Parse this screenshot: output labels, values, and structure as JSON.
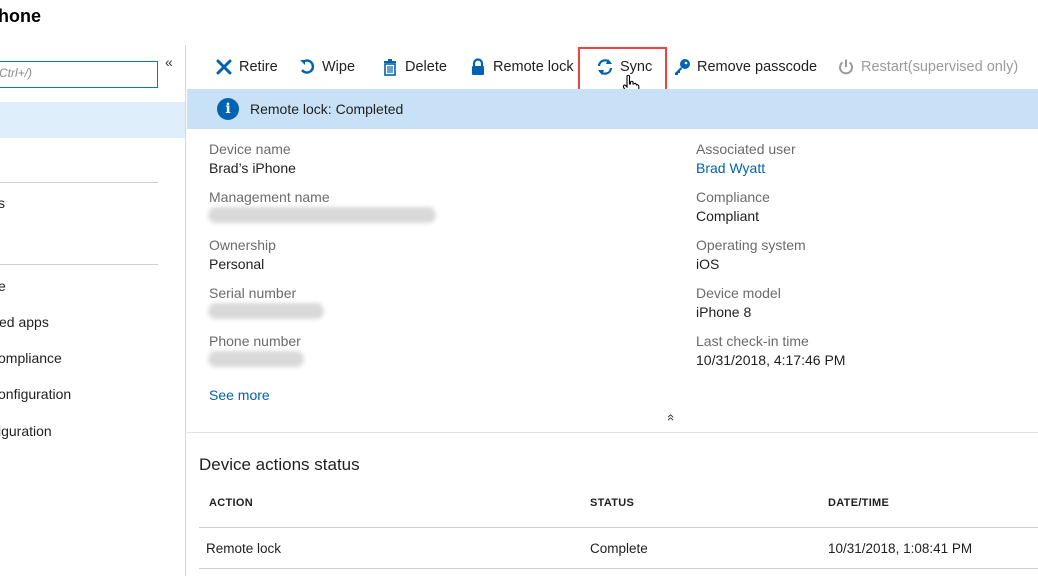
{
  "page": {
    "title": "hone"
  },
  "sidebar": {
    "collapse_glyph": "«",
    "search_placeholder": "Ctrl+/)",
    "items": [
      "s",
      "e",
      "ed apps",
      "ompliance",
      "onfiguration",
      "iguration"
    ]
  },
  "toolbar": {
    "retire": "Retire",
    "wipe": "Wipe",
    "delete": "Delete",
    "remote_lock": "Remote lock",
    "sync": "Sync",
    "remove_passcode": "Remove passcode",
    "restart": "Restart(supervised only)"
  },
  "banner": {
    "text": "Remote lock: Completed"
  },
  "details": {
    "device_name_label": "Device name",
    "device_name": "Brad’s iPhone",
    "management_name_label": "Management name",
    "ownership_label": "Ownership",
    "ownership": "Personal",
    "serial_label": "Serial number",
    "phone_label": "Phone number",
    "associated_user_label": "Associated user",
    "associated_user": "Brad Wyatt",
    "compliance_label": "Compliance",
    "compliance": "Compliant",
    "os_label": "Operating system",
    "os": "iOS",
    "model_label": "Device model",
    "model": "iPhone 8",
    "checkin_label": "Last check-in time",
    "checkin": "10/31/2018, 4:17:46 PM",
    "see_more": "See more",
    "collapse_glyph": "«"
  },
  "actions": {
    "title": "Device actions status",
    "columns": [
      "ACTION",
      "STATUS",
      "DATE/TIME"
    ],
    "rows": [
      [
        "Remote lock",
        "Complete",
        "10/31/2018, 1:08:41 PM"
      ]
    ]
  },
  "colors": {
    "accent": "#0063b1",
    "banner": "#c9e1f6",
    "highlight": "#e24848",
    "selected": "#dfeefb"
  }
}
